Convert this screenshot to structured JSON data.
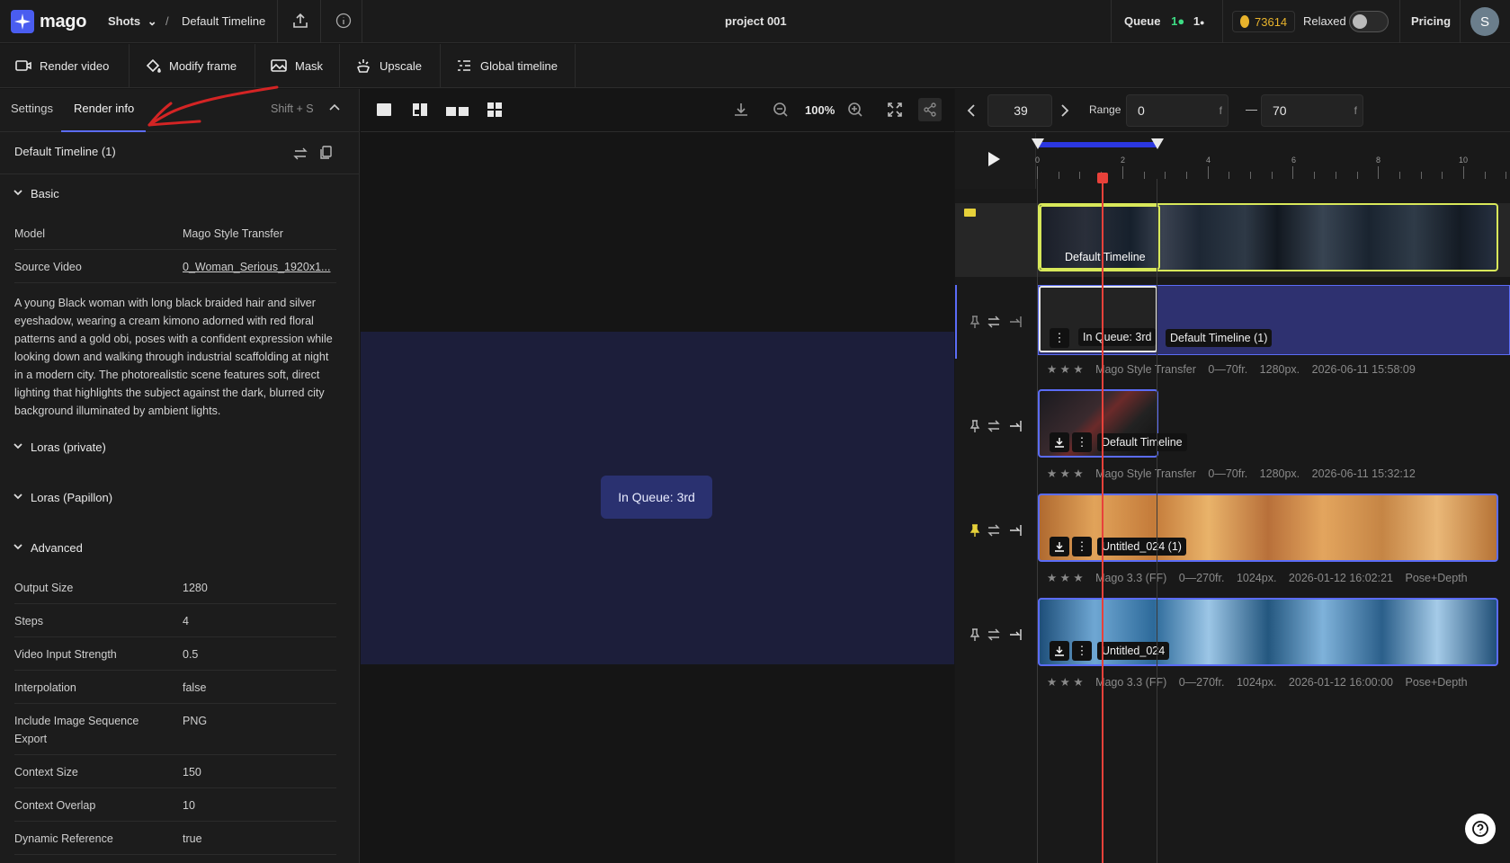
{
  "app": {
    "name": "mago",
    "brand_color": "#5b6cf7"
  },
  "breadcrumb": {
    "section": "Shots",
    "separator": "/",
    "page": "Default Timeline"
  },
  "header": {
    "project_title": "project 001",
    "queue_label": "Queue",
    "queue_count_a": "1",
    "queue_count_b": "1",
    "credits": "73614",
    "mode_label": "Relaxed",
    "pricing": "Pricing",
    "avatar_initial": "S"
  },
  "toolbar": {
    "render_video": "Render video",
    "modify_frame": "Modify frame",
    "mask": "Mask",
    "upscale": "Upscale",
    "global_timeline": "Global timeline"
  },
  "left_panel": {
    "tabs": {
      "settings": "Settings",
      "render_info": "Render info",
      "shortcut": "Shift + S"
    },
    "timeline_name": "Default Timeline (1)",
    "basic": {
      "title": "Basic",
      "model_label": "Model",
      "model_value": "Mago Style Transfer",
      "source_label": "Source Video",
      "source_value": "0_Woman_Serious_1920x1..."
    },
    "prompt": "A young Black woman with long black braided hair and silver eyeshadow, wearing a cream kimono adorned with red floral patterns and a gold obi, poses with a confident expression while looking down and walking through industrial scaffolding at night in a modern city. The photorealistic scene features soft, direct lighting that highlights the subject against the dark, blurred city background illuminated by ambient lights.",
    "sections": {
      "loras_private": "Loras (private)",
      "loras_papillon": "Loras (Papillon)",
      "advanced": "Advanced"
    },
    "advanced": [
      {
        "label": "Output Size",
        "value": "1280"
      },
      {
        "label": "Steps",
        "value": "4"
      },
      {
        "label": "Video Input Strength",
        "value": "0.5"
      },
      {
        "label": "Interpolation",
        "value": "false"
      },
      {
        "label": "Include Image Sequence Export",
        "value": "PNG"
      },
      {
        "label": "Context Size",
        "value": "150"
      },
      {
        "label": "Context Overlap",
        "value": "10"
      },
      {
        "label": "Dynamic Reference",
        "value": "true"
      }
    ]
  },
  "viewer": {
    "zoom": "100%",
    "queue_badge": "In Queue: 3rd"
  },
  "timeline": {
    "frame": "39",
    "range_label": "Range",
    "range_start": "0",
    "range_end": "70",
    "frame_unit": "f",
    "range_dash": "—",
    "ruler_ticks": [
      "0",
      "2",
      "4",
      "6",
      "8",
      "10"
    ],
    "base_clip_label": "Default Timeline",
    "tracks": [
      {
        "clip_label": "Default Timeline (1)",
        "status": "In Queue: 3rd",
        "model": "Mago Style Transfer",
        "frames": "0—70fr.",
        "size": "1280px.",
        "date": "2026-06-11 15:58:09",
        "extra": ""
      },
      {
        "clip_label": "Default Timeline",
        "status": "",
        "model": "Mago Style Transfer",
        "frames": "0—70fr.",
        "size": "1280px.",
        "date": "2026-06-11 15:32:12",
        "extra": ""
      },
      {
        "clip_label": "Untitled_024 (1)",
        "status": "",
        "model": "Mago 3.3 (FF)",
        "frames": "0—270fr.",
        "size": "1024px.",
        "date": "2026-01-12 16:02:21",
        "extra": "Pose+Depth"
      },
      {
        "clip_label": "Untitled_024",
        "status": "",
        "model": "Mago 3.3 (FF)",
        "frames": "0—270fr.",
        "size": "1024px.",
        "date": "2026-01-12 16:00:00",
        "extra": "Pose+Depth"
      }
    ],
    "stars": "★ ★ ★"
  },
  "colors": {
    "accent": "#5b6cf7",
    "playhead": "#e8413a",
    "selected_clip": "#d8e85a",
    "queue_green": "#3ddc84",
    "range_bar": "#2b37e0"
  }
}
